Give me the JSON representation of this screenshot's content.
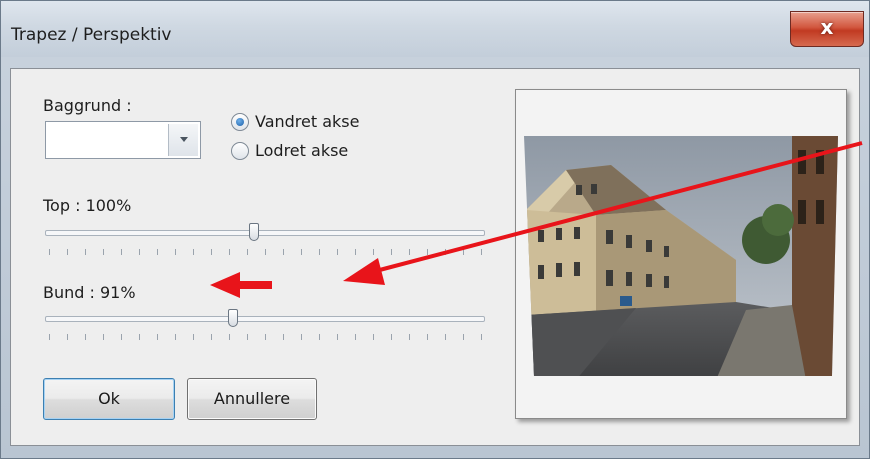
{
  "window": {
    "title": "Trapez / Perspektiv",
    "close_glyph": "x"
  },
  "background": {
    "label": "Baggrund :",
    "combo_value": "",
    "combo_arrow_icon": "chevron-down-icon"
  },
  "axis": {
    "horizontal_label": "Vandret akse",
    "horizontal_checked": true,
    "vertical_label": "Lodret akse",
    "vertical_checked": false
  },
  "top_slider": {
    "label": "Top : 100%",
    "value_percent": 100
  },
  "bottom_slider": {
    "label": "Bund : 91%",
    "value_percent": 91
  },
  "buttons": {
    "ok_label": "Ok",
    "cancel_label": "Annullere"
  },
  "preview": {
    "description_icon": "photo-preview"
  },
  "annotations": {
    "color": "#e8141a"
  },
  "colors": {
    "titlebar": "#cfd8e2",
    "close_button": "#c9452b",
    "client_bg": "#eeeeee"
  }
}
